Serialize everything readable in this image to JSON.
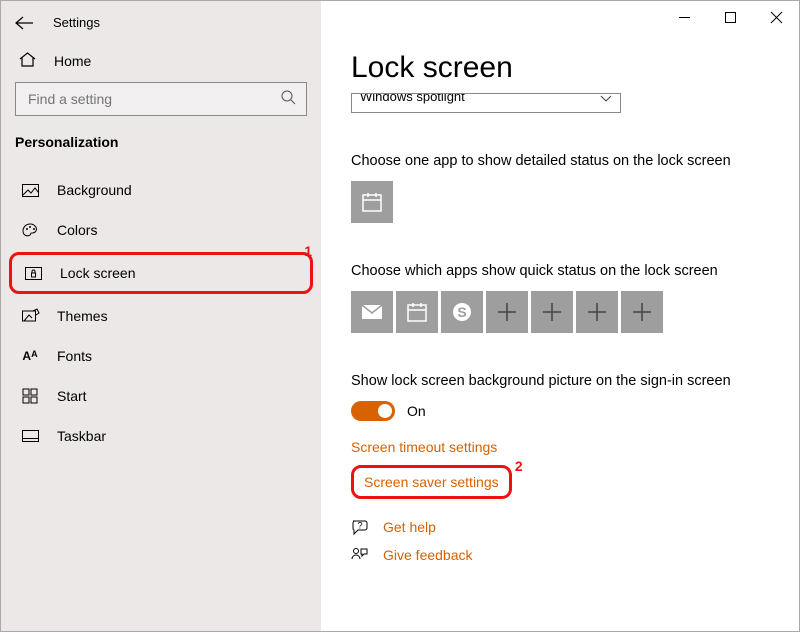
{
  "window": {
    "title": "Settings"
  },
  "sidebar": {
    "home": "Home",
    "search_placeholder": "Find a setting",
    "section": "Personalization",
    "items": [
      {
        "label": "Background"
      },
      {
        "label": "Colors"
      },
      {
        "label": "Lock screen"
      },
      {
        "label": "Themes"
      },
      {
        "label": "Fonts"
      },
      {
        "label": "Start"
      },
      {
        "label": "Taskbar"
      }
    ]
  },
  "main": {
    "title": "Lock screen",
    "background_dropdown": "Windows spotlight",
    "detailed_label": "Choose one app to show detailed status on the lock screen",
    "quick_label": "Choose which apps show quick status on the lock screen",
    "signin_bg_label": "Show lock screen background picture on the sign-in screen",
    "toggle_text": "On",
    "link_timeout": "Screen timeout settings",
    "link_screensaver": "Screen saver settings",
    "help": "Get help",
    "feedback": "Give feedback"
  },
  "annotations": {
    "one": "1",
    "two": "2"
  }
}
